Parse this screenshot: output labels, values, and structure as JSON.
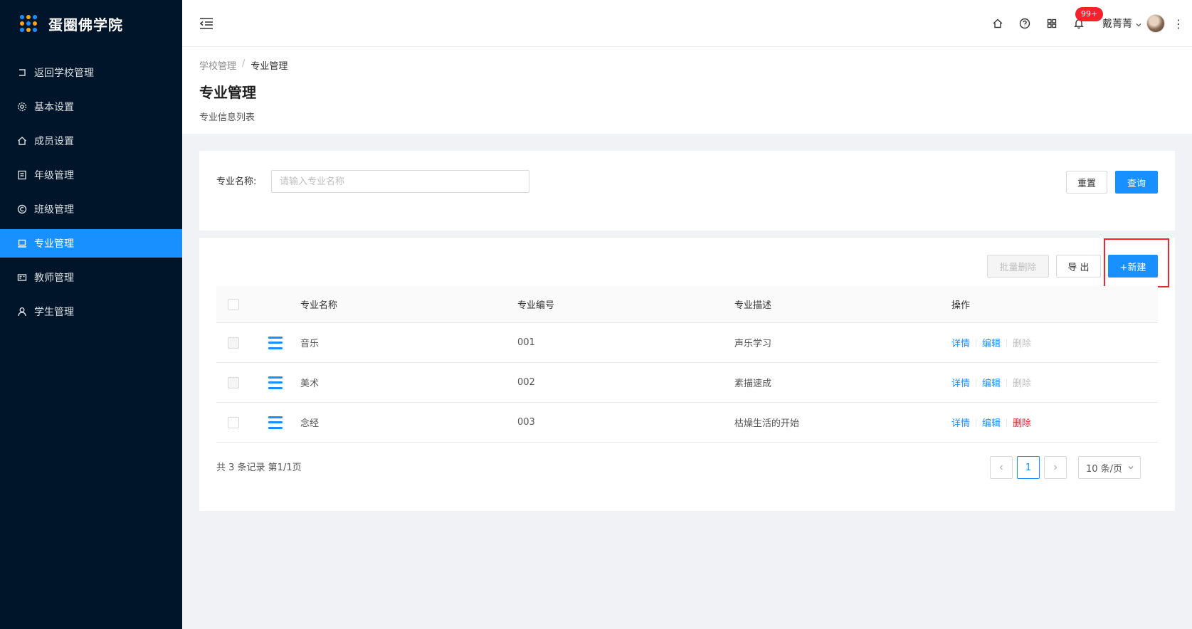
{
  "app": {
    "title": "蛋圈佛学院"
  },
  "sidebar": {
    "items": [
      {
        "label": "返回学校管理",
        "icon": "back-icon"
      },
      {
        "label": "基本设置",
        "icon": "gear-icon"
      },
      {
        "label": "成员设置",
        "icon": "home-icon"
      },
      {
        "label": "年级管理",
        "icon": "book-icon"
      },
      {
        "label": "班级管理",
        "icon": "copyright-icon"
      },
      {
        "label": "专业管理",
        "icon": "laptop-icon",
        "active": true
      },
      {
        "label": "教师管理",
        "icon": "id-card-icon"
      },
      {
        "label": "学生管理",
        "icon": "user-icon"
      }
    ]
  },
  "header": {
    "badge": "99+",
    "user_name": "戴菁菁",
    "more": "⋮"
  },
  "breadcrumb": {
    "parent": "学校管理",
    "separator": "/",
    "current": "专业管理"
  },
  "page": {
    "title": "专业管理",
    "subtitle": "专业信息列表"
  },
  "search": {
    "label": "专业名称:",
    "placeholder": "请输入专业名称",
    "reset_label": "重置",
    "query_label": "查询"
  },
  "toolbar": {
    "batch_delete_label": "批量删除",
    "export_label": "导 出",
    "new_label": "+新建"
  },
  "table": {
    "columns": [
      "专业名称",
      "专业编号",
      "专业描述",
      "操作"
    ],
    "rows": [
      {
        "name": "音乐",
        "code": "001",
        "desc": "声乐学习",
        "delete_enabled": false
      },
      {
        "name": "美术",
        "code": "002",
        "desc": "素描速成",
        "delete_enabled": false
      },
      {
        "name": "念经",
        "code": "003",
        "desc": "枯燥生活的开始",
        "delete_enabled": true
      }
    ],
    "actions": {
      "detail": "详情",
      "edit": "编辑",
      "delete": "删除"
    }
  },
  "pagination": {
    "summary": "共 3 条记录 第1/1页",
    "current_page": "1",
    "page_size": "10 条/页"
  },
  "colors": {
    "sidebar_bg": "#001529",
    "primary": "#1890ff",
    "danger": "#f5222d"
  }
}
